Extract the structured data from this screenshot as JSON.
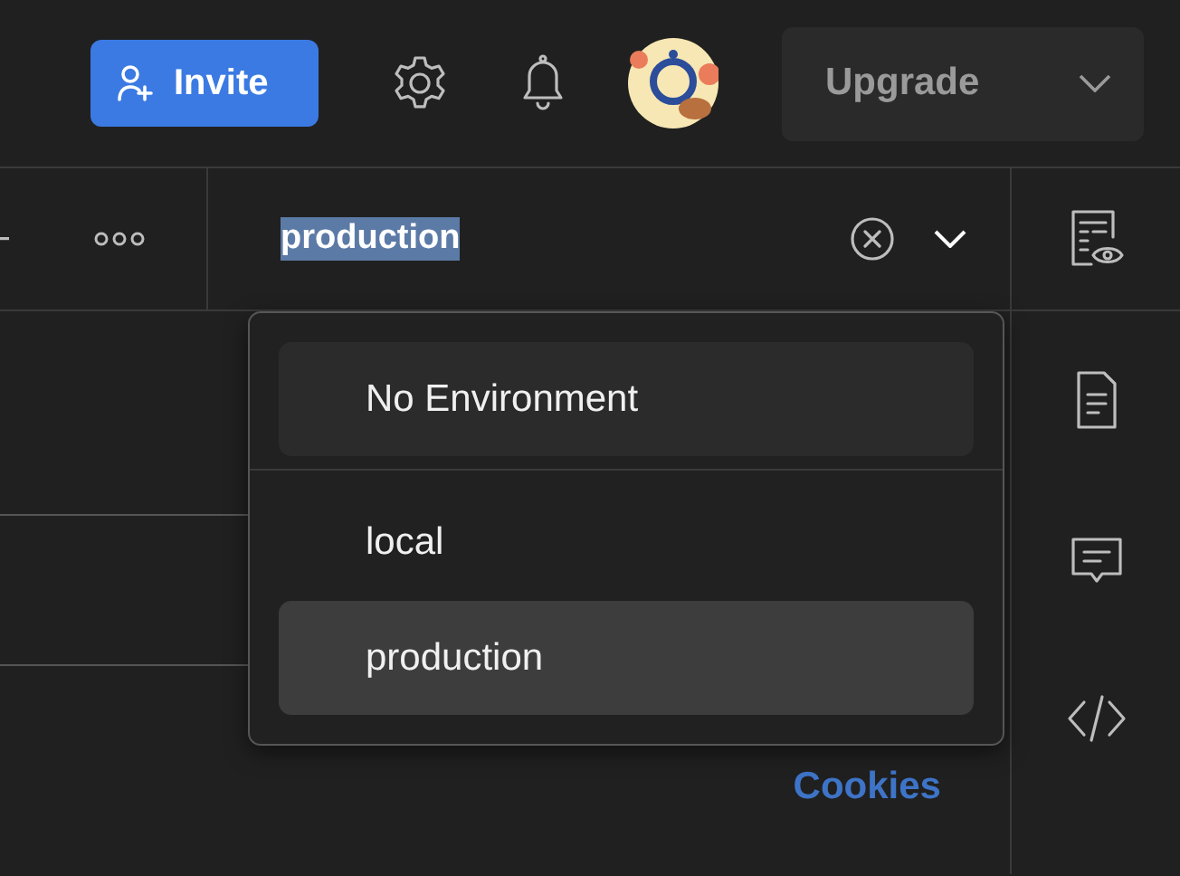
{
  "topbar": {
    "invite_button": "Invite",
    "upgrade_button": "Upgrade"
  },
  "environment": {
    "value": "production",
    "value_selected": true
  },
  "environment_menu": {
    "items": [
      {
        "label": "No Environment",
        "kind": "none",
        "selected": false
      },
      {
        "label": "local",
        "kind": "env",
        "selected": false
      },
      {
        "label": "production",
        "kind": "env",
        "selected": true
      }
    ]
  },
  "content": {
    "link": "Cookies"
  }
}
